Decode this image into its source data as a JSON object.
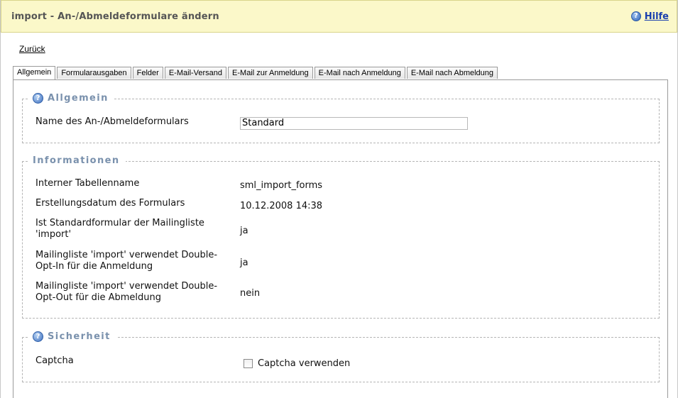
{
  "header": {
    "title": "import - An-/Abmeldeformulare ändern",
    "help_label": "Hilfe",
    "help_icon": "question-icon"
  },
  "back_link": "Zurück",
  "tabs": [
    {
      "label": "Allgemein",
      "active": true
    },
    {
      "label": "Formularausgaben",
      "active": false
    },
    {
      "label": "Felder",
      "active": false
    },
    {
      "label": "E-Mail-Versand",
      "active": false
    },
    {
      "label": "E-Mail zur Anmeldung",
      "active": false
    },
    {
      "label": "E-Mail nach Anmeldung",
      "active": false
    },
    {
      "label": "E-Mail nach Abmeldung",
      "active": false
    }
  ],
  "sections": {
    "allgemein": {
      "legend": "Allgemein",
      "name_label": "Name des An-/Abmeldeformulars",
      "name_value": "Standard"
    },
    "informationen": {
      "legend": "Informationen",
      "rows": [
        {
          "label": "Interner Tabellenname",
          "value": "sml_import_forms"
        },
        {
          "label": "Erstellungsdatum des Formulars",
          "value": "10.12.2008 14:38"
        },
        {
          "label": "Ist Standardformular der Mailingliste 'import'",
          "value": "ja"
        },
        {
          "label": "Mailingliste 'import' verwendet Double-Opt-In für die Anmeldung",
          "value": "ja"
        },
        {
          "label": "Mailingliste 'import' verwendet Double-Opt-Out für die Abmeldung",
          "value": "nein"
        }
      ]
    },
    "sicherheit": {
      "legend": "Sicherheit",
      "captcha_label": "Captcha",
      "captcha_checkbox_label": "Captcha verwenden",
      "captcha_checked": false
    }
  },
  "colors": {
    "header_bg": "#fbf8c9",
    "legend_text": "#7a91ad",
    "link": "#1a3fae"
  }
}
